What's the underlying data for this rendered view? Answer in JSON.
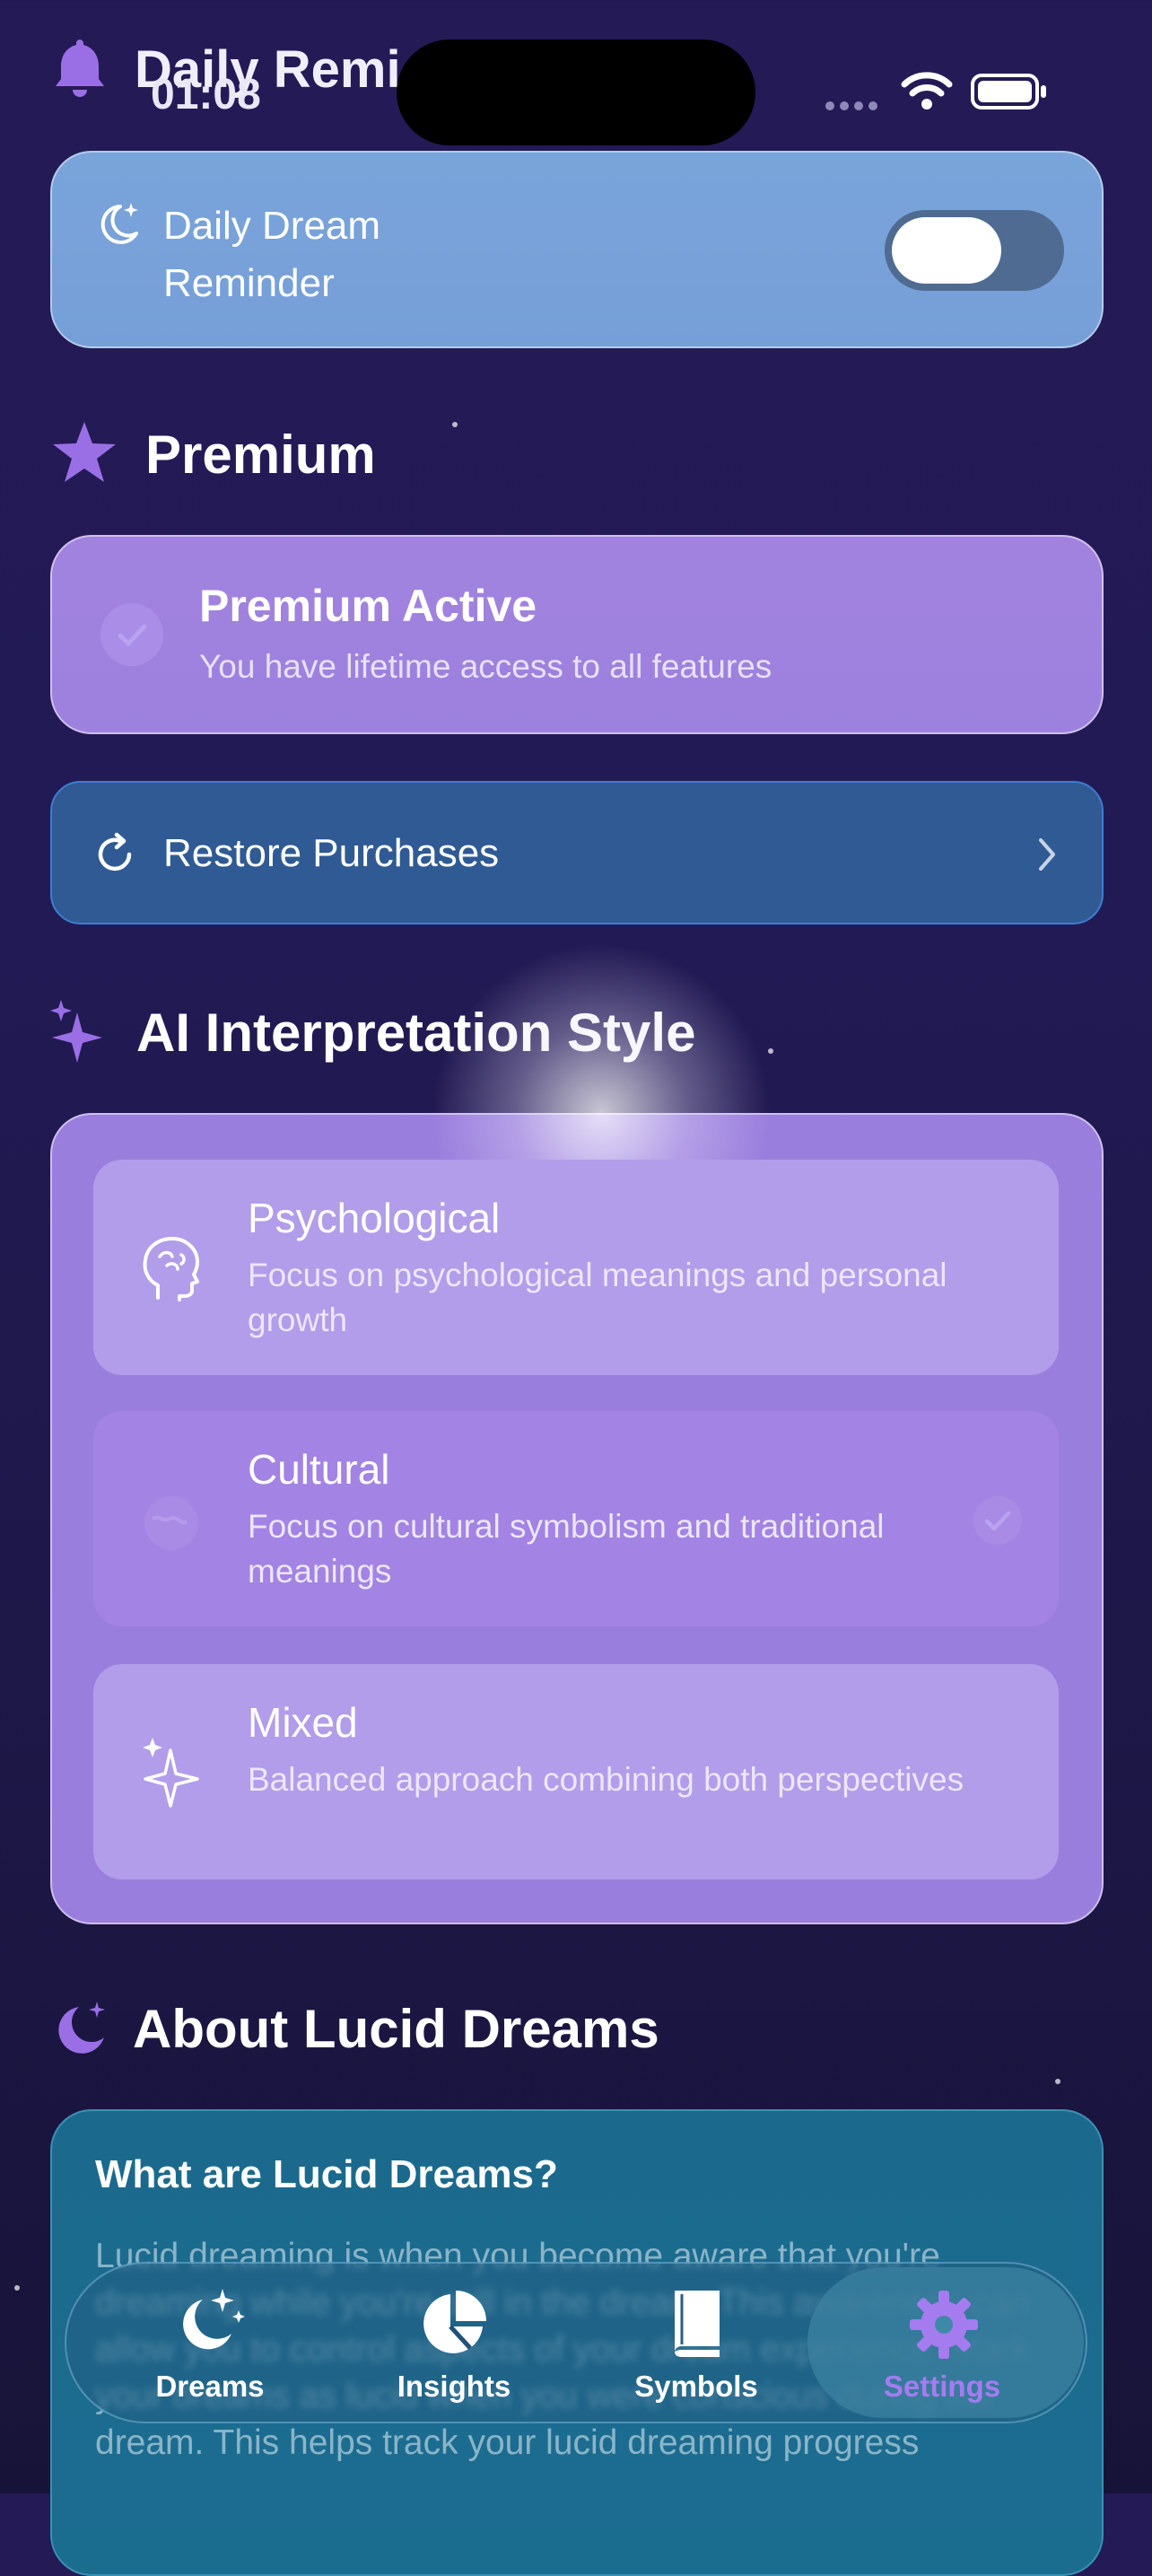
{
  "status_bar": {
    "time": "01:08"
  },
  "partial_header": {
    "title": "Daily Remi"
  },
  "reminder": {
    "label": "Daily Dream Reminder",
    "toggle_on": false
  },
  "premium": {
    "section_title": "Premium",
    "status_title": "Premium Active",
    "status_subtitle": "You have lifetime access to all features",
    "restore_label": "Restore Purchases"
  },
  "ai_style": {
    "section_title": "AI Interpretation Style",
    "options": [
      {
        "title": "Psychological",
        "description": "Focus on psychological meanings and personal growth",
        "icon": "brain-icon",
        "selected": false
      },
      {
        "title": "Cultural",
        "description": "Focus on cultural symbolism and traditional meanings",
        "icon": "globe-icon",
        "selected": true
      },
      {
        "title": "Mixed",
        "description": "Balanced approach combining both perspectives",
        "icon": "sparkles-icon",
        "selected": false
      }
    ]
  },
  "about": {
    "section_title": "About Lucid Dreams",
    "question": "What are Lucid Dreams?",
    "body": "Lucid dreaming is when you become aware that you're dreaming while you're still in the dream. This awareness can allow you to control aspects of your dream experience. Mark your dreams as lucid when you were conscious during the dream. This helps track your lucid dreaming progress"
  },
  "tabbar": {
    "tabs": [
      {
        "label": "Dreams",
        "icon": "moon-stars-icon",
        "active": false
      },
      {
        "label": "Insights",
        "icon": "pie-chart-icon",
        "active": false
      },
      {
        "label": "Symbols",
        "icon": "book-icon",
        "active": false
      },
      {
        "label": "Settings",
        "icon": "gear-icon",
        "active": true
      }
    ]
  },
  "colors": {
    "accent_purple": "#9a6fe6",
    "tab_active": "#a57cf0",
    "tab_inactive": "#ffffff",
    "background": "#221a55"
  }
}
